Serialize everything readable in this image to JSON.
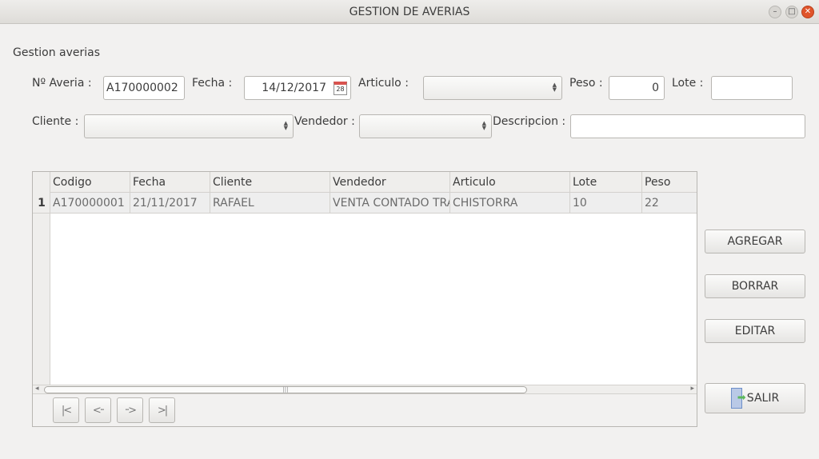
{
  "window": {
    "title": "GESTION DE AVERIAS"
  },
  "form": {
    "section_title": "Gestion averias",
    "averia_label": "Nº Averia :",
    "averia_value": "A170000002",
    "fecha_label": "Fecha :",
    "fecha_value": "14/12/2017",
    "calendar_day": "28",
    "articulo_label": "Articulo :",
    "articulo_value": "",
    "peso_label": "Peso :",
    "peso_value": "0",
    "lote_label": "Lote :",
    "lote_value": "",
    "cliente_label": "Cliente :",
    "cliente_value": "",
    "vendedor_label": "Vendedor :",
    "vendedor_value": "",
    "descripcion_label": "Descripcion :",
    "descripcion_value": ""
  },
  "table": {
    "columns": [
      "Codigo",
      "Fecha",
      "Cliente",
      "Vendedor",
      "Articulo",
      "Lote",
      "Peso"
    ],
    "rows": [
      {
        "num": "1",
        "cells": [
          "A170000001",
          "21/11/2017",
          "RAFAEL",
          "VENTA CONTADO TRA",
          "CHISTORRA",
          "10",
          "22"
        ]
      }
    ],
    "scroll_grip": "|||"
  },
  "nav": {
    "first": "|<",
    "prev": "<··",
    "next": "··>",
    "last": ">|"
  },
  "buttons": {
    "agregar": "AGREGAR",
    "borrar": "BORRAR",
    "editar": "EDITAR",
    "salir": "SALIR"
  },
  "icons": {
    "minimize": "minimize-icon",
    "maximize": "maximize-icon",
    "close": "close-icon",
    "calendar": "calendar-icon",
    "exit": "exit-door-icon"
  },
  "colors": {
    "accent_close": "#e0542a",
    "calendar_red": "#d9534f",
    "exit_arrow": "#5cb85c"
  }
}
